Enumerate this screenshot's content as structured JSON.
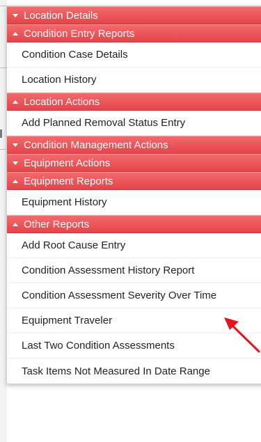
{
  "accent_color": "#e94e52",
  "annotation_arrow_color": "#e8141b",
  "sections": [
    {
      "label": "Location Details",
      "state": "collapsed",
      "items": []
    },
    {
      "label": "Condition Entry Reports",
      "state": "expanded",
      "items": [
        "Condition Case Details",
        "Location History"
      ]
    },
    {
      "label": "Location Actions",
      "state": "expanded",
      "items": [
        "Add Planned Removal Status Entry"
      ]
    },
    {
      "label": "Condition Management Actions",
      "state": "collapsed",
      "items": []
    },
    {
      "label": "Equipment Actions",
      "state": "collapsed",
      "items": []
    },
    {
      "label": "Equipment Reports",
      "state": "expanded",
      "items": [
        "Equipment History"
      ]
    },
    {
      "label": "Other Reports",
      "state": "expanded",
      "items": [
        "Add Root Cause Entry",
        "Condition Assessment History Report",
        "Condition Assessment Severity Over Time",
        "Equipment Traveler",
        "Last Two Condition Assessments",
        "Task Items Not Measured In Date Range"
      ]
    }
  ]
}
